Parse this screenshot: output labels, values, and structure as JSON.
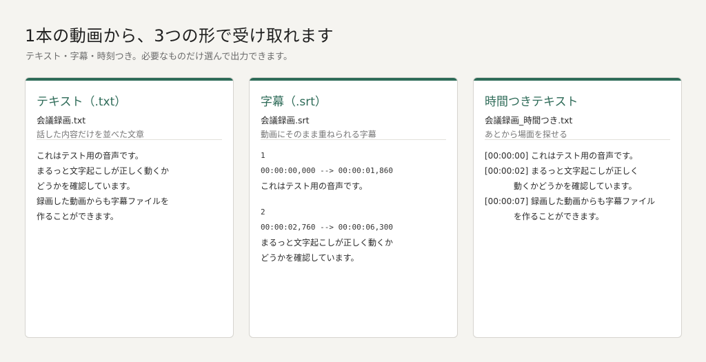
{
  "header": {
    "title": "1本の動画から、3つの形で受け取れます",
    "subtitle": "テキスト・字幕・時刻つき。必要なものだけ選んで出力できます。"
  },
  "cards": [
    {
      "title": "テキスト（.txt）",
      "filename": "会議録画.txt",
      "description": "話した内容だけを並べた文章",
      "lines": [
        "これはテスト用の音声です。",
        "まるっと文字起こしが正しく動くか",
        "どうかを確認しています。",
        "録画した動画からも字幕ファイルを",
        "作ることができます。"
      ]
    },
    {
      "title": "字幕（.srt）",
      "filename": "会議録画.srt",
      "description": "動画にそのまま重ねられる字幕",
      "entries": [
        {
          "index": "1",
          "time": "00:00:00,000 --> 00:00:01,860",
          "text": [
            "これはテスト用の音声です。"
          ]
        },
        {
          "index": "2",
          "time": "00:00:02,760 --> 00:00:06,300",
          "text": [
            "まるっと文字起こしが正しく動くか",
            "どうかを確認しています。"
          ]
        }
      ]
    },
    {
      "title": "時間つきテキスト",
      "filename": "会議録画_時間つき.txt",
      "description": "あとから場面を探せる",
      "lines": [
        "[00:00:00] これはテスト用の音声です。",
        "[00:00:02] まるっと文字起こしが正しく",
        "動くかどうかを確認しています。",
        "[00:00:07] 録画した動画からも字幕ファイル",
        "を作ることができます。"
      ]
    }
  ],
  "colors": {
    "accent": "#2e6b58",
    "background": "#f5f4f0",
    "card": "#ffffff"
  }
}
